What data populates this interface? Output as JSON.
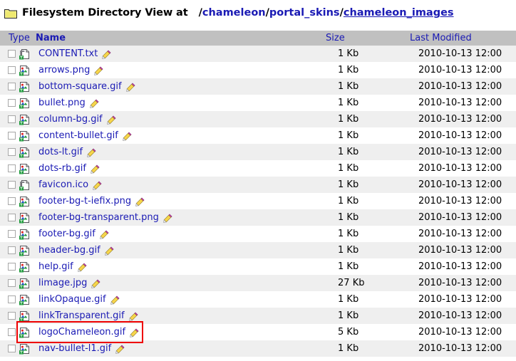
{
  "header": {
    "folder_icon": "folder-icon",
    "title": "Filesystem Directory View at",
    "path_segments": [
      {
        "text": "/",
        "kind": "sep"
      },
      {
        "text": "chameleon",
        "kind": "seg"
      },
      {
        "text": "/",
        "kind": "sep"
      },
      {
        "text": "portal_skins",
        "kind": "seg"
      },
      {
        "text": "/",
        "kind": "sep"
      },
      {
        "text": "chameleon_images",
        "kind": "cur"
      }
    ],
    "path_plain": "/chameleon/portal_skins/chameleon_images"
  },
  "table": {
    "columns": {
      "type": "Type",
      "name": "Name",
      "size": "Size",
      "modified": "Last Modified"
    },
    "rows": [
      {
        "name": "CONTENT.txt",
        "icon": "document-icon",
        "size": "1 Kb",
        "modified": "2010-10-13 12:00",
        "checked": false,
        "highlighted": false
      },
      {
        "name": "arrows.png",
        "icon": "image-icon",
        "size": "1 Kb",
        "modified": "2010-10-13 12:00",
        "checked": false,
        "highlighted": false
      },
      {
        "name": "bottom-square.gif",
        "icon": "image-icon",
        "size": "1 Kb",
        "modified": "2010-10-13 12:00",
        "checked": false,
        "highlighted": false
      },
      {
        "name": "bullet.png",
        "icon": "image-icon",
        "size": "1 Kb",
        "modified": "2010-10-13 12:00",
        "checked": false,
        "highlighted": false
      },
      {
        "name": "column-bg.gif",
        "icon": "image-icon",
        "size": "1 Kb",
        "modified": "2010-10-13 12:00",
        "checked": false,
        "highlighted": false
      },
      {
        "name": "content-bullet.gif",
        "icon": "image-icon",
        "size": "1 Kb",
        "modified": "2010-10-13 12:00",
        "checked": false,
        "highlighted": false
      },
      {
        "name": "dots-lt.gif",
        "icon": "image-icon",
        "size": "1 Kb",
        "modified": "2010-10-13 12:00",
        "checked": false,
        "highlighted": false
      },
      {
        "name": "dots-rb.gif",
        "icon": "image-icon",
        "size": "1 Kb",
        "modified": "2010-10-13 12:00",
        "checked": false,
        "highlighted": false
      },
      {
        "name": "favicon.ico",
        "icon": "document-icon",
        "size": "1 Kb",
        "modified": "2010-10-13 12:00",
        "checked": false,
        "highlighted": false
      },
      {
        "name": "footer-bg-t-iefix.png",
        "icon": "image-icon",
        "size": "1 Kb",
        "modified": "2010-10-13 12:00",
        "checked": false,
        "highlighted": false
      },
      {
        "name": "footer-bg-transparent.png",
        "icon": "image-icon",
        "size": "1 Kb",
        "modified": "2010-10-13 12:00",
        "checked": false,
        "highlighted": false
      },
      {
        "name": "footer-bg.gif",
        "icon": "image-icon",
        "size": "1 Kb",
        "modified": "2010-10-13 12:00",
        "checked": false,
        "highlighted": false
      },
      {
        "name": "header-bg.gif",
        "icon": "image-icon",
        "size": "1 Kb",
        "modified": "2010-10-13 12:00",
        "checked": false,
        "highlighted": false
      },
      {
        "name": "help.gif",
        "icon": "image-icon",
        "size": "1 Kb",
        "modified": "2010-10-13 12:00",
        "checked": false,
        "highlighted": false
      },
      {
        "name": "limage.jpg",
        "icon": "image-icon",
        "size": "27 Kb",
        "modified": "2010-10-13 12:00",
        "checked": false,
        "highlighted": false
      },
      {
        "name": "linkOpaque.gif",
        "icon": "image-icon",
        "size": "1 Kb",
        "modified": "2010-10-13 12:00",
        "checked": false,
        "highlighted": false
      },
      {
        "name": "linkTransparent.gif",
        "icon": "image-icon",
        "size": "1 Kb",
        "modified": "2010-10-13 12:00",
        "checked": false,
        "highlighted": false
      },
      {
        "name": "logoChameleon.gif",
        "icon": "image-icon",
        "size": "5 Kb",
        "modified": "2010-10-13 12:00",
        "checked": false,
        "highlighted": true
      },
      {
        "name": "nav-bullet-l1.gif",
        "icon": "image-icon",
        "size": "1 Kb",
        "modified": "2010-10-13 12:00",
        "checked": false,
        "highlighted": false
      }
    ]
  },
  "icons": {
    "edit": "pencil-icon",
    "checkbox": "row-checkbox"
  },
  "colors": {
    "link": "#1a1ab4",
    "header_row_bg": "#c0c0c0",
    "stripe_bg": "#efefef",
    "highlight_border": "#ee0000",
    "text": "#000000"
  }
}
